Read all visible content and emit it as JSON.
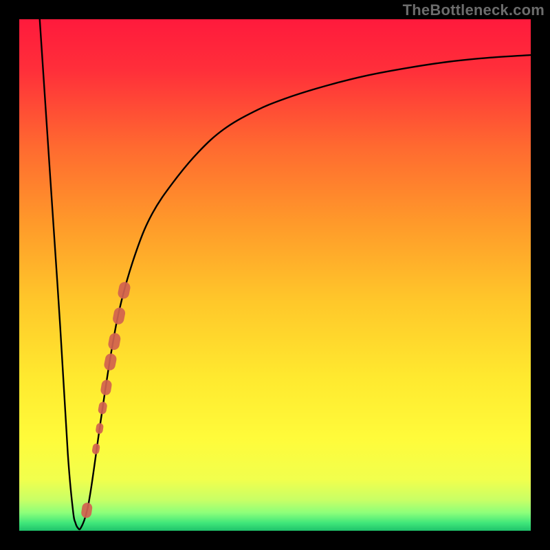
{
  "watermark": "TheBottleneck.com",
  "gradient": {
    "stops": [
      {
        "offset": 0.0,
        "color": "#ff1a3c"
      },
      {
        "offset": 0.1,
        "color": "#ff2f3a"
      },
      {
        "offset": 0.25,
        "color": "#ff6a30"
      },
      {
        "offset": 0.4,
        "color": "#ff9a2a"
      },
      {
        "offset": 0.55,
        "color": "#ffc72a"
      },
      {
        "offset": 0.7,
        "color": "#ffe92f"
      },
      {
        "offset": 0.82,
        "color": "#fffb3a"
      },
      {
        "offset": 0.9,
        "color": "#f1ff4d"
      },
      {
        "offset": 0.94,
        "color": "#c8ff66"
      },
      {
        "offset": 0.965,
        "color": "#8cff7a"
      },
      {
        "offset": 0.985,
        "color": "#3fe67a"
      },
      {
        "offset": 1.0,
        "color": "#1fc26b"
      }
    ]
  },
  "chart_data": {
    "type": "line",
    "title": "",
    "xlabel": "",
    "ylabel": "",
    "xlim": [
      0,
      100
    ],
    "ylim": [
      0,
      100
    ],
    "series": [
      {
        "name": "curve",
        "x": [
          4,
          6,
          8,
          9.5,
          10.5,
          11,
          11.5,
          12,
          13,
          14,
          16,
          18,
          20,
          23,
          26,
          30,
          35,
          40,
          46,
          52,
          60,
          68,
          76,
          84,
          92,
          100
        ],
        "y": [
          100,
          70,
          40,
          15,
          4,
          1.5,
          0.5,
          0.5,
          3,
          8,
          22,
          35,
          45,
          55,
          62,
          68,
          74,
          78.5,
          82,
          84.5,
          87,
          89,
          90.5,
          91.7,
          92.5,
          93
        ]
      }
    ],
    "markers": {
      "name": "highlight-strip",
      "color_hex": "#d1624f",
      "points": [
        {
          "x": 13.2,
          "y": 4,
          "r": 1.0
        },
        {
          "x": 15.0,
          "y": 16,
          "r": 0.7
        },
        {
          "x": 15.7,
          "y": 20,
          "r": 0.7
        },
        {
          "x": 16.3,
          "y": 24,
          "r": 0.8
        },
        {
          "x": 17.0,
          "y": 28,
          "r": 1.0
        },
        {
          "x": 17.8,
          "y": 33,
          "r": 1.1
        },
        {
          "x": 18.6,
          "y": 37,
          "r": 1.1
        },
        {
          "x": 19.5,
          "y": 42,
          "r": 1.1
        },
        {
          "x": 20.5,
          "y": 47,
          "r": 1.1
        }
      ]
    }
  }
}
